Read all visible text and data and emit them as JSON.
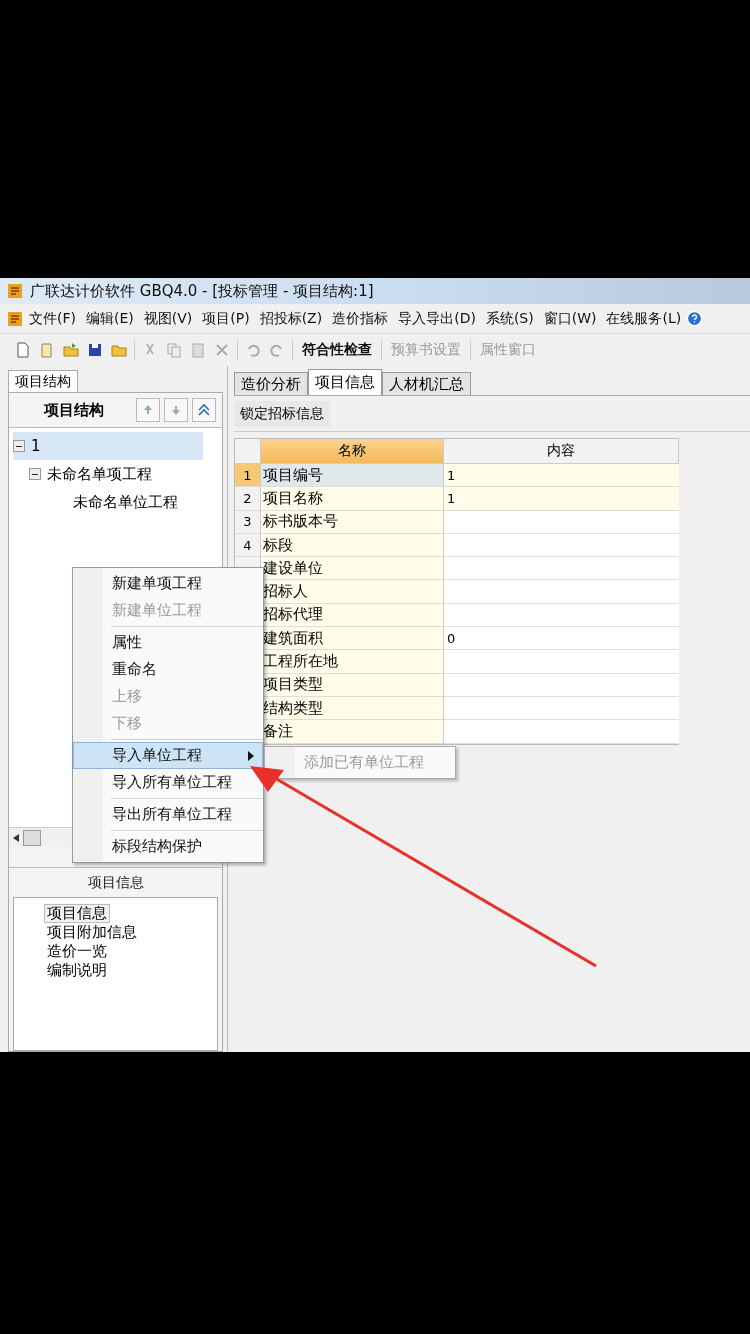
{
  "window": {
    "title": "广联达计价软件 GBQ4.0 - [投标管理 - 项目结构:1]"
  },
  "menu_bar": [
    "文件(F)",
    "编辑(E)",
    "视图(V)",
    "项目(P)",
    "招投标(Z)",
    "造价指标",
    "导入导出(D)",
    "系统(S)",
    "窗口(W)",
    "在线服务(L)"
  ],
  "toolbar": {
    "buttons": [
      {
        "label": "符合性检查",
        "disabled": false
      },
      {
        "label": "预算书设置",
        "disabled": true
      },
      {
        "label": "属性窗口",
        "disabled": true
      }
    ]
  },
  "left_panel": {
    "tab": "项目结构",
    "header": "项目结构",
    "tree": [
      {
        "label": "1",
        "selected": true,
        "expanded": true,
        "children": [
          {
            "label": "未命名单项工程",
            "selected": false,
            "expanded": true,
            "children": [
              {
                "label": "未命名单位工程",
                "selected": false
              }
            ]
          }
        ]
      }
    ],
    "info_header": "项目信息",
    "info_tree": [
      {
        "label": "项目信息",
        "selected": true
      },
      {
        "label": "项目附加信息",
        "selected": false
      },
      {
        "label": "造价一览",
        "selected": false
      },
      {
        "label": "编制说明",
        "selected": false
      }
    ]
  },
  "tabs": [
    {
      "label": "造价分析",
      "selected": false
    },
    {
      "label": "项目信息",
      "selected": true
    },
    {
      "label": "人材机汇总",
      "selected": false
    }
  ],
  "lock_button": "锁定招标信息",
  "table": {
    "columns": [
      "名称",
      "内容"
    ],
    "rows": [
      {
        "number": "1",
        "name": "项目编号",
        "content": "1",
        "selected": true
      },
      {
        "number": "2",
        "name": "项目名称",
        "content": "1",
        "selected": false
      },
      {
        "number": "3",
        "name": "标书版本号",
        "selected": false
      },
      {
        "number": "4",
        "name": "标段",
        "selected": false
      },
      {
        "name": "建设单位",
        "selected": false
      },
      {
        "name": "招标人",
        "selected": false
      },
      {
        "name": "招标代理",
        "selected": false
      },
      {
        "name": "建筑面积",
        "content": "0",
        "selected": false
      },
      {
        "name": "工程所在地",
        "selected": false
      },
      {
        "name": "项目类型",
        "selected": false
      },
      {
        "name": "结构类型",
        "selected": false
      },
      {
        "name": "备注",
        "selected": false
      }
    ]
  },
  "context_menu": [
    {
      "kind": "item",
      "label": "新建单项工程",
      "disabled": false,
      "selected": false
    },
    {
      "kind": "item",
      "label": "新建单位工程",
      "disabled": true,
      "selected": false
    },
    {
      "kind": "separator"
    },
    {
      "kind": "item",
      "label": "属性",
      "disabled": false,
      "selected": false
    },
    {
      "kind": "item",
      "label": "重命名",
      "disabled": false,
      "selected": false
    },
    {
      "kind": "item",
      "label": "上移",
      "disabled": true,
      "selected": false
    },
    {
      "kind": "item",
      "label": "下移",
      "disabled": true,
      "selected": false
    },
    {
      "kind": "separator"
    },
    {
      "kind": "item",
      "label": "导入单位工程",
      "disabled": false,
      "selected": true,
      "submenu": true
    },
    {
      "kind": "item",
      "label": "导入所有单位工程",
      "disabled": false,
      "selected": false
    },
    {
      "kind": "separator"
    },
    {
      "kind": "item",
      "label": "导出所有单位工程",
      "disabled": false,
      "selected": false
    },
    {
      "kind": "separator"
    },
    {
      "kind": "item",
      "label": "标段结构保护",
      "disabled": false,
      "selected": false
    }
  ],
  "submenu": [
    {
      "label": "添加已有单位工程",
      "disabled": true
    }
  ]
}
